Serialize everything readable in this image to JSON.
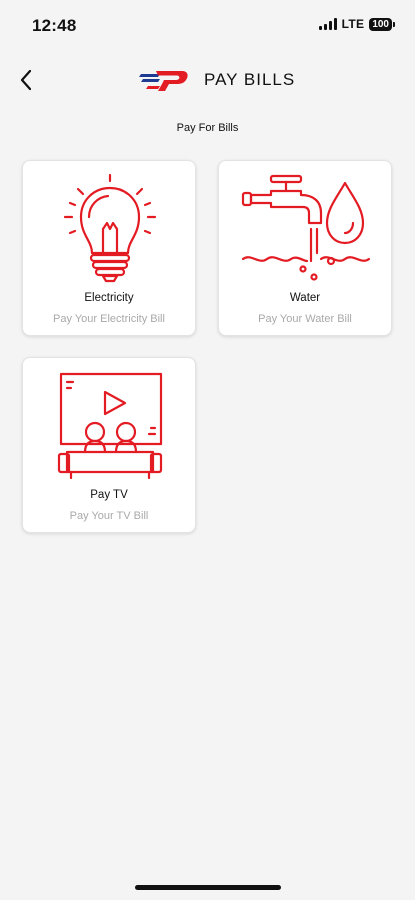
{
  "status": {
    "time": "12:48",
    "network": "LTE",
    "battery": "100"
  },
  "header": {
    "title": "PAY BILLS"
  },
  "section_title": "Pay For Bills",
  "cards": [
    {
      "title": "Electricity",
      "subtitle": "Pay Your Electricity Bill",
      "icon": "light-bulb-icon"
    },
    {
      "title": "Water",
      "subtitle": "Pay Your Water Bill",
      "icon": "water-tap-icon"
    },
    {
      "title": "Pay TV",
      "subtitle": "Pay Your TV Bill",
      "icon": "tv-viewers-icon"
    }
  ],
  "colors": {
    "accent": "#e31b23",
    "brand_blue": "#1f3a93",
    "background": "#f4f4f4"
  }
}
